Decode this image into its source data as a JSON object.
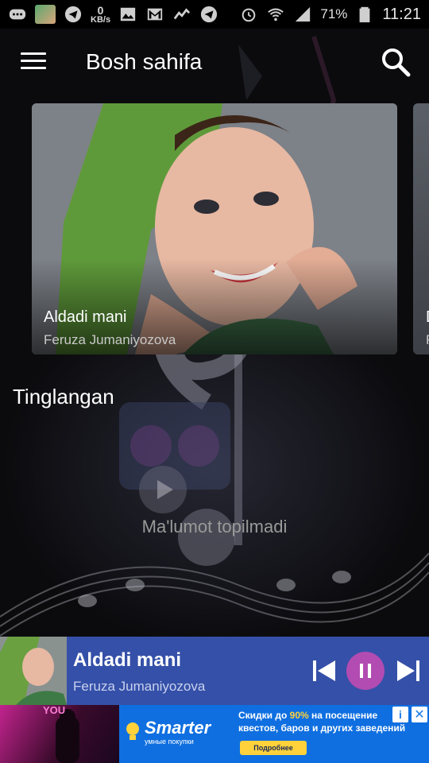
{
  "status_bar": {
    "network_speed_value": "0",
    "network_speed_unit": "KB/s",
    "battery_percent": "71%",
    "time": "11:21",
    "icons": [
      "messages-icon",
      "photo-thumbnail",
      "telegram-icon",
      "gallery-icon",
      "gmail-icon",
      "analytics-icon",
      "telegram-icon-2",
      "alarm-icon",
      "wifi-icon",
      "signal-icon",
      "battery-icon"
    ]
  },
  "header": {
    "title": "Bosh sahifa",
    "menu_icon": "hamburger-menu-icon",
    "search_icon": "search-icon"
  },
  "carousel": {
    "items": [
      {
        "title": "Aldadi mani",
        "artist": "Feruza Jumaniyozova"
      },
      {
        "title": "D",
        "artist": "F"
      }
    ]
  },
  "section": {
    "title": "Tinglangan",
    "empty_message": "Ma'lumot topilmadi"
  },
  "player": {
    "title": "Aldadi mani",
    "artist": "Feruza Jumaniyozova",
    "colors": {
      "background": "#3550a8",
      "pause_button": "#b24cb2"
    }
  },
  "ad": {
    "left_text": "YOU",
    "brand": "Smarter",
    "brand_sub": "умные покупки",
    "line_prefix": "Скидки до ",
    "line_highlight": "90%",
    "line_rest": " на посещение квестов, баров и других заведений",
    "button": "Подробнее",
    "info_icon": "i",
    "close_icon": "✕"
  }
}
